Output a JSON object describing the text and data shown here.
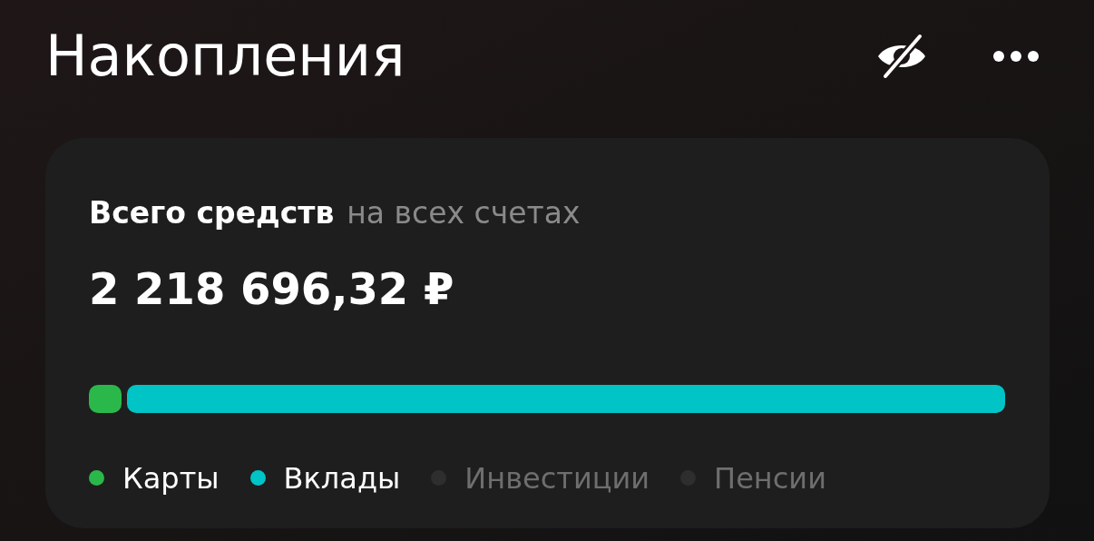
{
  "header": {
    "title": "Накопления"
  },
  "card": {
    "label": "Всего средств",
    "sublabel": "на всех счетах",
    "amount": "2 218 696,32 ₽",
    "bar": {
      "segments": [
        {
          "color": "#2bb84a"
        },
        {
          "color": "#00c4c6"
        }
      ]
    },
    "legend": [
      {
        "label": "Карты",
        "color": "#2bb84a",
        "active": true
      },
      {
        "label": "Вклады",
        "color": "#00c4c6",
        "active": true
      },
      {
        "label": "Инвестиции",
        "color": "#2e2e2e",
        "active": false
      },
      {
        "label": "Пенсии",
        "color": "#2e2e2e",
        "active": false
      }
    ]
  }
}
